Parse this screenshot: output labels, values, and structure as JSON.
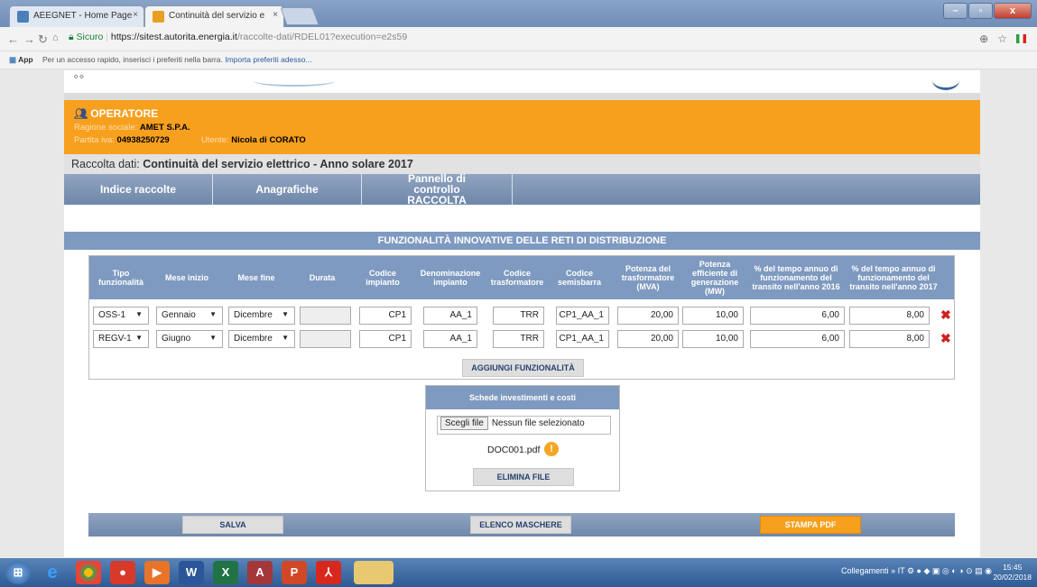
{
  "browser": {
    "tabs": [
      {
        "title": "AEEGNET - Home Page"
      },
      {
        "title": "Continuità del servizio e"
      }
    ],
    "tab_close": "×",
    "window_buttons": [
      "–",
      "▫",
      "x"
    ],
    "url_secure": "Sicuro",
    "url_host": "https://sitest.autorita.energia.it",
    "url_path": "/raccolte-dati/RDEL01?execution=e2s59",
    "bookmarks_apps": "App",
    "bookmarks_text": "Per un accesso rapido, inserisci i preferiti nella barra.",
    "bookmarks_link": "Importa preferiti adesso..."
  },
  "operator": {
    "title": "OPERATORE",
    "ragione_label": "Ragione sociale:",
    "ragione_value": "AMET S.P.A.",
    "piva_label": "Partita iva:",
    "piva_value": "04938250729",
    "utente_label": "Utente:",
    "utente_value": "Nicola di CORATO"
  },
  "raccolta": {
    "label": "Raccolta dati:",
    "title": "Continuità del servizio elettrico - Anno solare 2017"
  },
  "nav": [
    {
      "label": "Indice raccolte"
    },
    {
      "label": "Anagrafiche"
    },
    {
      "label": "Pannello di controllo RACCOLTA"
    }
  ],
  "section_title": "FUNZIONALITÀ INNOVATIVE DELLE RETI DI DISTRIBUZIONE",
  "table": {
    "headers": [
      "Tipo funzionalità",
      "Mese inizio",
      "Mese fine",
      "Durata",
      "Codice impianto",
      "Denominazione impianto",
      "Codice trasformatore",
      "Codice semisbarra",
      "Potenza del trasformatore (MVA)",
      "Potenza efficiente di generazione (MW)",
      "% del tempo annuo di funzionamento del transito nell'anno 2016",
      "% del tempo annuo di funzionamento del transito nell'anno 2017"
    ],
    "rows": [
      {
        "tipo": "OSS-1",
        "mese_inizio": "Gennaio",
        "mese_fine": "Dicembre",
        "durata": "",
        "codice_impianto": "CP1",
        "denominazione": "AA_1",
        "trasformatore": "TRR",
        "semisbarra": "CP1_AA_1",
        "potenza_mva": "20,00",
        "potenza_mw": "10,00",
        "pct_2016": "6,00",
        "pct_2017": "8,00"
      },
      {
        "tipo": "REGV-1",
        "mese_inizio": "Giugno",
        "mese_fine": "Dicembre",
        "durata": "",
        "codice_impianto": "CP1",
        "denominazione": "AA_1",
        "trasformatore": "TRR",
        "semisbarra": "CP1_AA_1",
        "potenza_mva": "20,00",
        "potenza_mw": "10,00",
        "pct_2016": "6,00",
        "pct_2017": "8,00"
      }
    ],
    "add_button": "AGGIUNGI FUNZIONALITÀ",
    "dropdown_arrow": "▼",
    "delete_glyph": "✖"
  },
  "schede": {
    "title": "Schede investimenti e costi",
    "choose_button": "Scegli file",
    "no_file": "Nessun file selezionato",
    "filename": "DOC001.pdf",
    "info_glyph": "!",
    "delete_button": "ELIMINA FILE"
  },
  "footer": {
    "save": "SALVA",
    "elenco": "ELENCO MASCHERE",
    "print": "STAMPA PDF"
  },
  "taskbar": {
    "tray_label": "Collegamenti",
    "lang": "IT",
    "time": "15:45",
    "date": "20/02/2018"
  },
  "colors": {
    "operator_bg": "#f7a01e",
    "header_blue": "#7f9ac0",
    "delete_red": "#d02020"
  }
}
